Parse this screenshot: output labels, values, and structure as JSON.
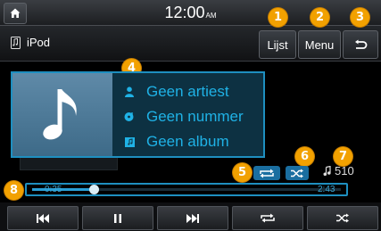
{
  "status": {
    "time": "12:00",
    "ampm": "AM"
  },
  "header": {
    "source_label": "iPod",
    "list_label": "Lijst",
    "menu_label": "Menu"
  },
  "track": {
    "artist": "Geen artiest",
    "title": "Geen nummer",
    "album": "Geen album"
  },
  "playback": {
    "elapsed": "0:35",
    "total": "2:43",
    "progress": 0.2,
    "track_count": "510"
  },
  "badges": [
    "1",
    "2",
    "3",
    "4",
    "5",
    "6",
    "7",
    "8"
  ],
  "icons": {
    "home": "home-icon",
    "source": "ipod-icon",
    "back": "back-arrow-icon",
    "artist": "person-icon",
    "title": "music-disc-icon",
    "album": "album-icon",
    "repeat_mode": "repeat-icon",
    "shuffle_mode": "shuffle-icon",
    "track_count": "music-note-icon",
    "prev": "previous-track-icon",
    "pause": "pause-icon",
    "next": "next-track-icon",
    "repeat": "repeat-icon",
    "shuffle": "shuffle-icon"
  },
  "colors": {
    "accent": "#1fb2e6",
    "badge": "#f2a100",
    "panel": "#0d3142",
    "album_art": "#4f7d9c"
  }
}
